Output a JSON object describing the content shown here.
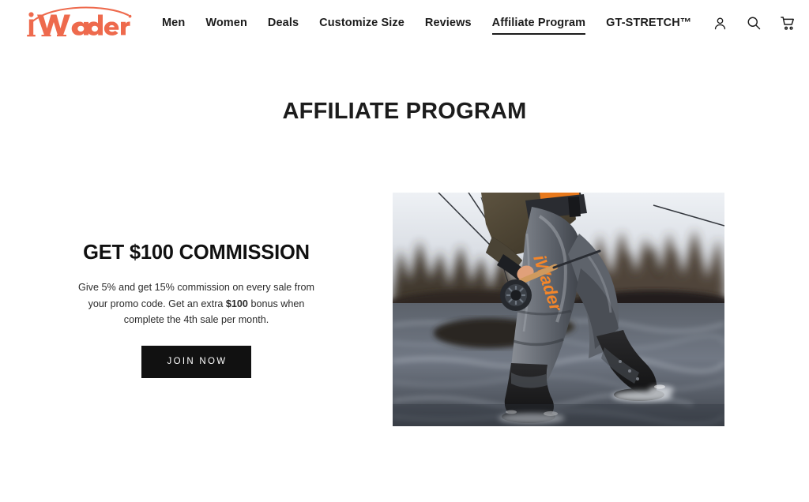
{
  "brand": {
    "name": "iWader",
    "logo_color": "#ee6a4d",
    "logo_icon": "iwader-wordmark-with-fishing-rod-arc"
  },
  "header": {
    "nav_items": [
      {
        "label": "Men",
        "active": false
      },
      {
        "label": "Women",
        "active": false
      },
      {
        "label": "Deals",
        "active": false
      },
      {
        "label": "Customize Size",
        "active": false
      },
      {
        "label": "Reviews",
        "active": false
      },
      {
        "label": "Affiliate Program",
        "active": true
      },
      {
        "label": "GT-STRETCH™",
        "active": false
      }
    ],
    "actions": [
      {
        "name": "account-icon",
        "label": "Account"
      },
      {
        "name": "search-icon",
        "label": "Search"
      },
      {
        "name": "cart-icon",
        "label": "Cart"
      }
    ]
  },
  "page": {
    "title": "AFFILIATE PROGRAM"
  },
  "hero": {
    "heading": "GET $100 COMMISSION",
    "paragraph_part1": "Give 5% and get 15% commission on every sale from your promo code. Get an extra ",
    "paragraph_bold": "$100",
    "paragraph_part2": " bonus when complete the 4th sale per month.",
    "cta_label": "JOIN NOW",
    "image": {
      "name": "fly-fisherman-wearing-iwader-waders-in-river",
      "alt": "Angler in gray iWader waders and boots standing in a river holding a fly rod",
      "brand_mark_on_waders": "iWader",
      "brand_mark_color": "#f4862a"
    }
  },
  "colors": {
    "brand_orange": "#ee6a4d",
    "text_dark": "#1c1c1c",
    "button_black": "#111111",
    "page_background": "#ffffff"
  }
}
